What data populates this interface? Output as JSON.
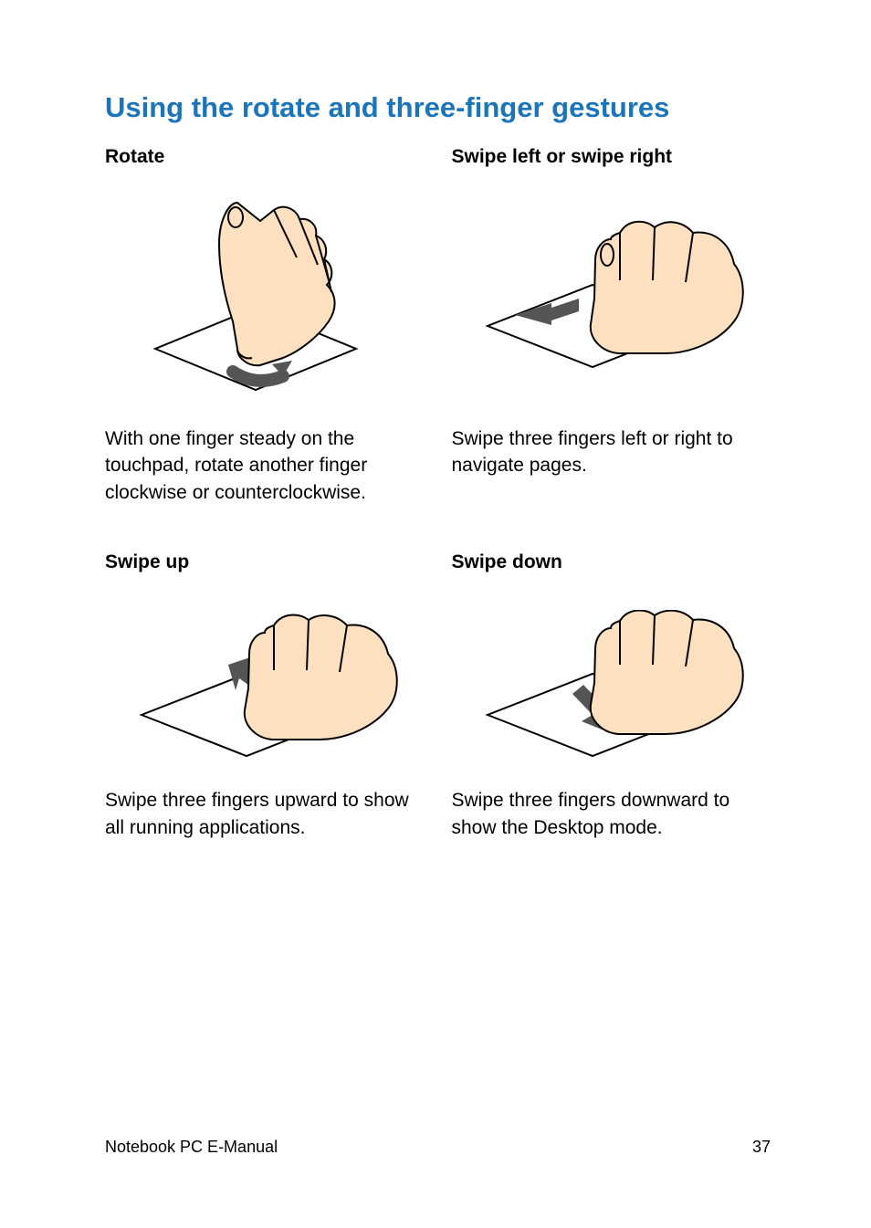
{
  "title": "Using the rotate and three-finger gestures",
  "gestures": {
    "rotate": {
      "label": "Rotate",
      "desc": "With one finger steady on the touchpad, rotate another finger clockwise or counterclockwise."
    },
    "swipe_lr": {
      "label": "Swipe left or swipe right",
      "desc": "Swipe three fingers left or right to navigate pages."
    },
    "swipe_up": {
      "label": "Swipe up",
      "desc": "Swipe three fingers upward to show all running applications."
    },
    "swipe_down": {
      "label": "Swipe down",
      "desc": "Swipe three fingers downward to show the Desktop mode."
    }
  },
  "footer": {
    "doc_title": "Notebook PC E-Manual",
    "page_number": "37"
  }
}
